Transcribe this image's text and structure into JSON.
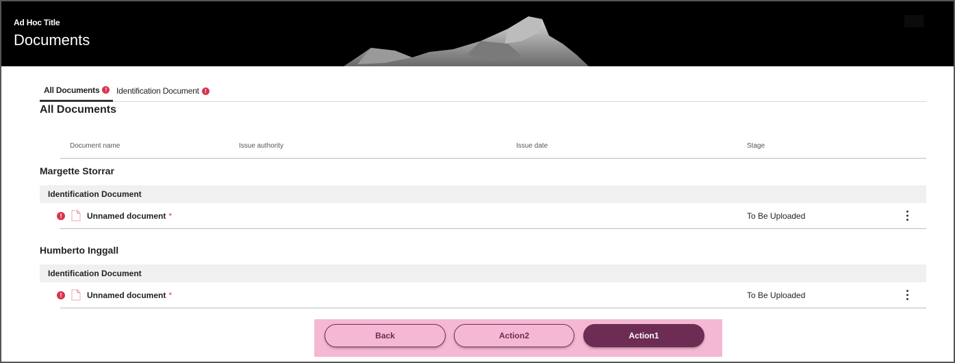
{
  "header": {
    "sup_title": "Ad Hoc Title",
    "title": "Documents"
  },
  "tabs": [
    {
      "label": "All Documents",
      "active": true,
      "alert": "!"
    },
    {
      "label": "Identification Document",
      "active": false,
      "alert": "!"
    }
  ],
  "section_title": "All Documents",
  "table": {
    "columns": [
      "Document name",
      "Issue authority",
      "Issue date",
      "Stage"
    ]
  },
  "people": [
    {
      "name": "Margette Storrar",
      "group": "Identification Document",
      "document": {
        "name": "Unnamed document",
        "required_mark": "*",
        "stage": "To Be Uploaded",
        "alert": "!"
      }
    },
    {
      "name": "Humberto Inggall",
      "group": "Identification Document",
      "document": {
        "name": "Unnamed document",
        "required_mark": "*",
        "stage": "To Be Uploaded",
        "alert": "!"
      }
    }
  ],
  "actions": {
    "back": "Back",
    "action2": "Action2",
    "action1": "Action1"
  },
  "colors": {
    "header_bg": "#000000",
    "alert": "#d8344a",
    "button_bar_bg": "#f5b8d4",
    "primary": "#6d2c54"
  },
  "icons": {
    "alert": "exclamation-circle-icon",
    "file": "document-icon",
    "menu": "kebab-menu-icon"
  }
}
